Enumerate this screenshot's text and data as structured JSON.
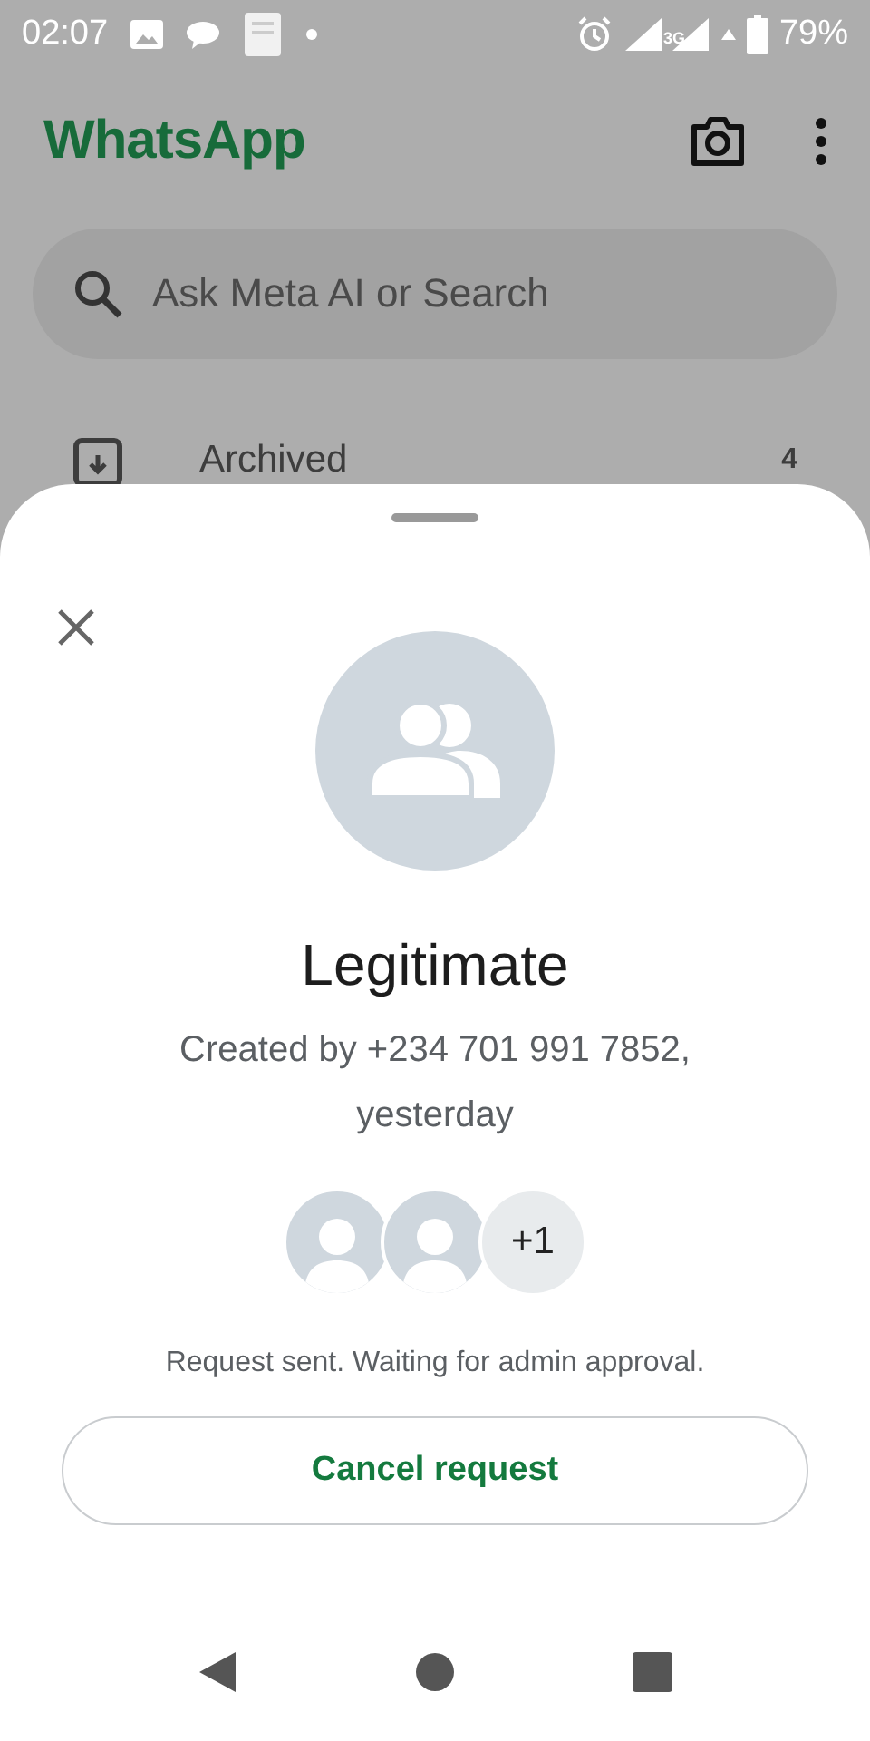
{
  "status_bar": {
    "time": "02:07",
    "network": "3G",
    "battery": "79%"
  },
  "app_bar": {
    "title": "WhatsApp"
  },
  "search": {
    "placeholder": "Ask Meta AI or Search"
  },
  "archived": {
    "label": "Archived",
    "count": "4"
  },
  "sheet": {
    "title": "Legitimate",
    "subtitle": "Created by +234 701 991 7852, yesterday",
    "members": [
      {
        "kind": "avatar"
      },
      {
        "kind": "avatar"
      },
      {
        "kind": "count",
        "label": "+1"
      }
    ],
    "status": "Request sent. Waiting for admin approval.",
    "button": "Cancel request"
  }
}
